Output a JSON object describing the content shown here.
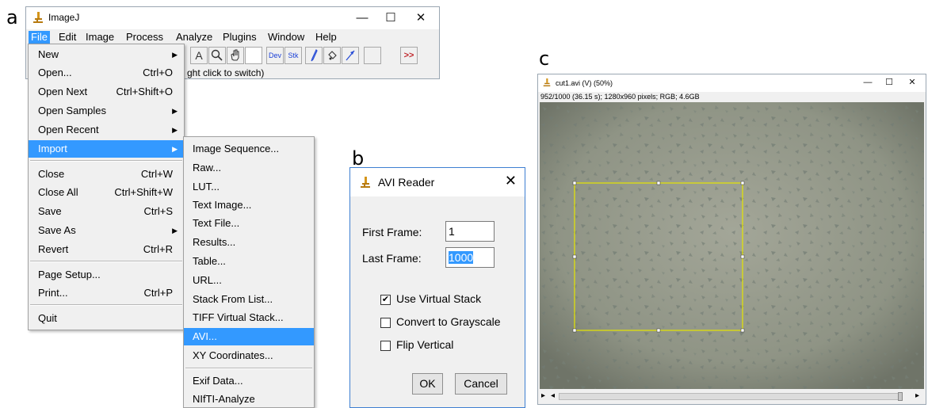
{
  "panel_labels": {
    "a": "a",
    "b": "b",
    "c": "c"
  },
  "imagej": {
    "title": "ImageJ",
    "window_controls": {
      "minimize": "—",
      "maximize": "☐",
      "close": "✕"
    },
    "menus": [
      "File",
      "Edit",
      "Image",
      "Process",
      "Analyze",
      "Plugins",
      "Window",
      "Help"
    ],
    "active_menu": "File",
    "tools": [
      "A",
      "🔍",
      "✋",
      "",
      "Dev",
      "Stk",
      "∕",
      "♁",
      "⟋",
      "",
      ">>"
    ],
    "status_text": "ght click to switch)"
  },
  "file_menu": {
    "items": [
      {
        "label": "New",
        "shortcut": "",
        "submenu": true
      },
      {
        "label": "Open...",
        "shortcut": "Ctrl+O",
        "submenu": false
      },
      {
        "label": "Open Next",
        "shortcut": "Ctrl+Shift+O",
        "submenu": false
      },
      {
        "label": "Open Samples",
        "shortcut": "",
        "submenu": true
      },
      {
        "label": "Open Recent",
        "shortcut": "",
        "submenu": true
      },
      {
        "label": "Import",
        "shortcut": "",
        "submenu": true,
        "highlighted": true
      },
      {
        "label": "Close",
        "shortcut": "Ctrl+W",
        "submenu": false
      },
      {
        "label": "Close All",
        "shortcut": "Ctrl+Shift+W",
        "submenu": false
      },
      {
        "label": "Save",
        "shortcut": "Ctrl+S",
        "submenu": false
      },
      {
        "label": "Save As",
        "shortcut": "",
        "submenu": true
      },
      {
        "label": "Revert",
        "shortcut": "Ctrl+R",
        "submenu": false
      },
      {
        "label": "Page Setup...",
        "shortcut": "",
        "submenu": false
      },
      {
        "label": "Print...",
        "shortcut": "Ctrl+P",
        "submenu": false
      },
      {
        "label": "Quit",
        "shortcut": "",
        "submenu": false
      }
    ]
  },
  "import_menu": {
    "items": [
      "Image Sequence...",
      "Raw...",
      "LUT...",
      "Text Image...",
      "Text File...",
      "Results...",
      "Table...",
      "URL...",
      "Stack From List...",
      "TIFF Virtual Stack...",
      "AVI...",
      "XY Coordinates...",
      "Exif Data...",
      "NIfTI-Analyze"
    ],
    "highlighted": "AVI..."
  },
  "avi_reader": {
    "title": "AVI Reader",
    "close": "✕",
    "first_frame_label": "First Frame:",
    "first_frame_value": "1",
    "last_frame_label": "Last Frame:",
    "last_frame_value": "1000",
    "checkboxes": [
      {
        "label": "Use Virtual Stack",
        "checked": true
      },
      {
        "label": "Convert to Grayscale",
        "checked": false
      },
      {
        "label": "Flip Vertical",
        "checked": false
      }
    ],
    "ok_label": "OK",
    "cancel_label": "Cancel"
  },
  "image_window": {
    "title": "cut1.avi (V) (50%)",
    "info": "952/1000 (36.15 s); 1280x960 pixels; RGB; 4.6GB",
    "window_controls": {
      "minimize": "—",
      "maximize": "☐",
      "close": "✕"
    },
    "scroll_left": "◂",
    "scroll_right": "▸"
  },
  "colors": {
    "menu_highlight": "#3399ff",
    "roi": "#e6e600",
    "dialog_border": "#3e7fd1",
    "image_background": "#8f9485"
  }
}
